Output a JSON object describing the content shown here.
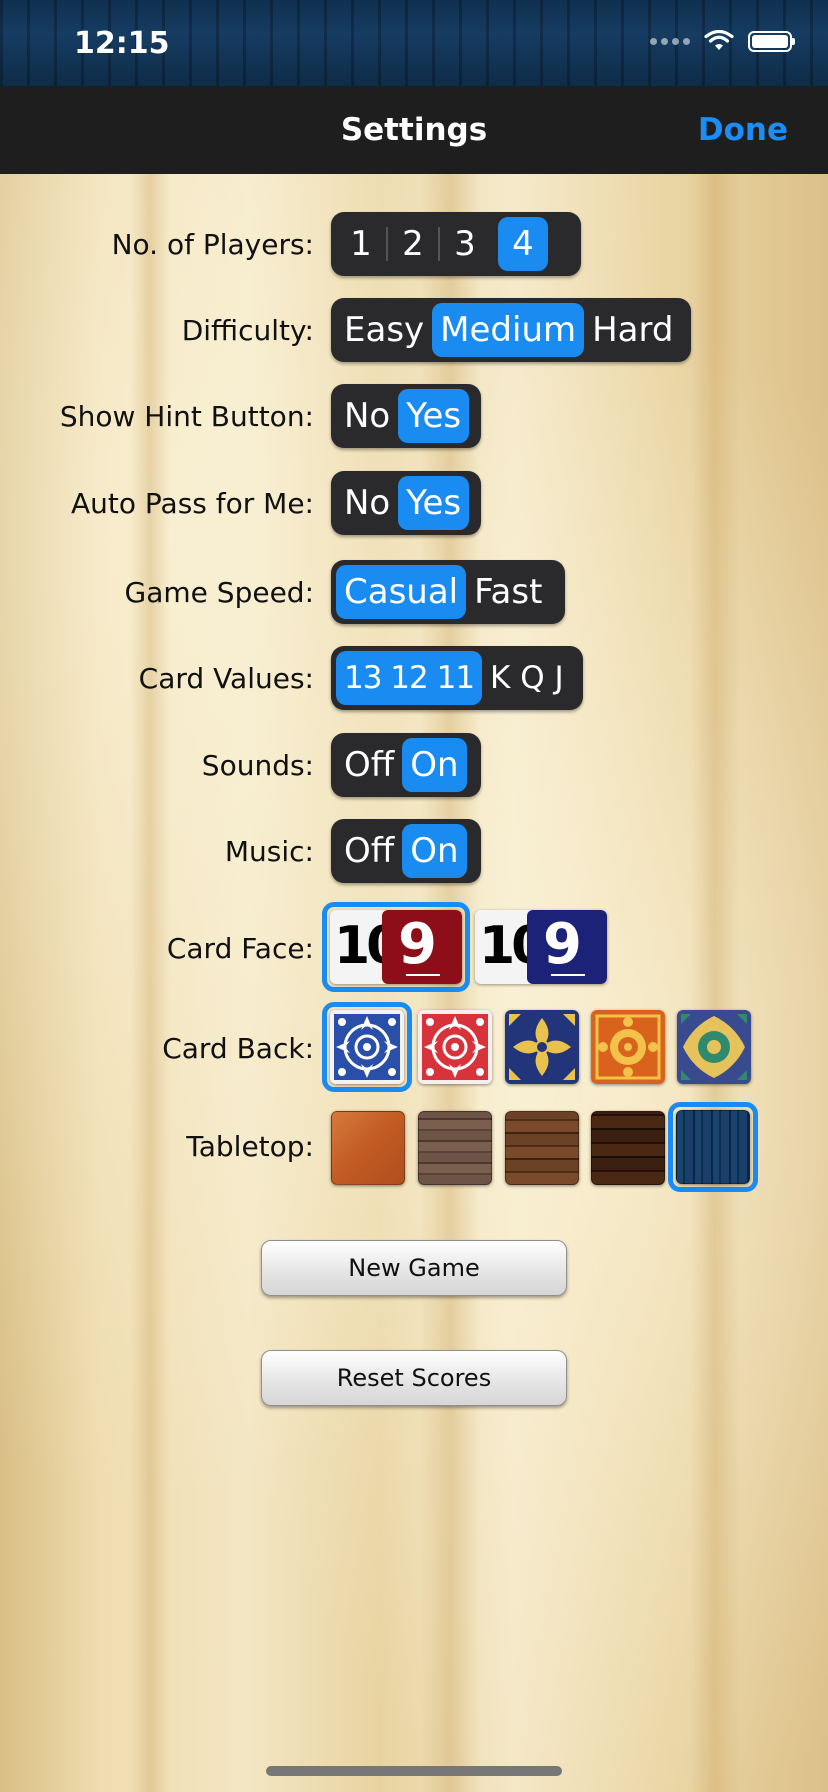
{
  "status_bar": {
    "time": "12:15"
  },
  "nav": {
    "title": "Settings",
    "done_label": "Done"
  },
  "settings": {
    "players": {
      "label": "No. of Players:",
      "options": [
        "1",
        "2",
        "3",
        "4"
      ],
      "selected": "4"
    },
    "difficulty": {
      "label": "Difficulty:",
      "options": [
        "Easy",
        "Medium",
        "Hard"
      ],
      "selected": "Medium"
    },
    "hint_button": {
      "label": "Show Hint Button:",
      "options": [
        "No",
        "Yes"
      ],
      "selected": "Yes"
    },
    "auto_pass": {
      "label": "Auto Pass for Me:",
      "options": [
        "No",
        "Yes"
      ],
      "selected": "Yes"
    },
    "game_speed": {
      "label": "Game Speed:",
      "options": [
        "Casual",
        "Fast"
      ],
      "selected": "Casual"
    },
    "card_values": {
      "label": "Card Values:",
      "options": [
        "13 12 11",
        "K Q J"
      ],
      "selected": "13 12 11"
    },
    "sounds": {
      "label": "Sounds:",
      "options": [
        "Off",
        "On"
      ],
      "selected": "On"
    },
    "music": {
      "label": "Music:",
      "options": [
        "Off",
        "On"
      ],
      "selected": "On"
    },
    "card_face": {
      "label": "Card Face:",
      "options": [
        {
          "ten": "10",
          "nine": "9",
          "color": "#8d0e18"
        },
        {
          "ten": "10",
          "nine": "9",
          "color": "#1b2277"
        }
      ],
      "selected_index": 0
    },
    "card_back": {
      "label": "Card Back:",
      "options": [
        {
          "name": "blue-ornate-back",
          "color": "#2a4fa8"
        },
        {
          "name": "red-ornate-back",
          "color": "#d8323a"
        },
        {
          "name": "navy-gold-tile-back",
          "color": "#23357a"
        },
        {
          "name": "orange-gold-tile-back",
          "color": "#d9621c"
        },
        {
          "name": "blue-green-tile-back",
          "color": "#3a4a8f"
        }
      ],
      "selected_index": 0
    },
    "tabletop": {
      "label": "Tabletop:",
      "options": [
        {
          "name": "cherry-wood",
          "color": "#c9652b"
        },
        {
          "name": "gray-plank-wood",
          "color": "#6e5446"
        },
        {
          "name": "brown-plank-wood",
          "color": "#6b4226"
        },
        {
          "name": "dark-plank-wood",
          "color": "#3b1f10"
        },
        {
          "name": "blue-wood",
          "color": "#163e66"
        }
      ],
      "selected_index": 4
    }
  },
  "actions": {
    "new_game": "New Game",
    "reset_scores": "Reset Scores"
  },
  "colors": {
    "accent": "#1a8cf1",
    "segment_bg": "#2a2a2c",
    "nav_bg": "#1e1e1e"
  }
}
